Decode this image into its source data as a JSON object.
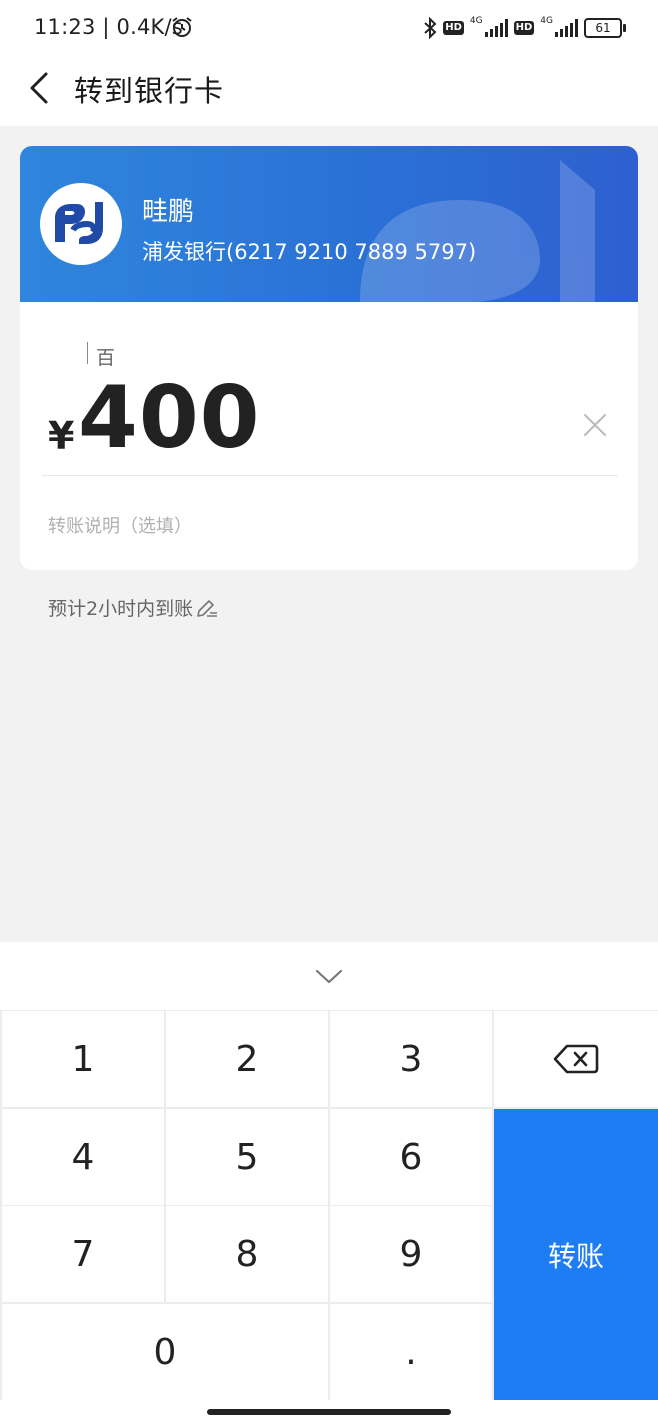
{
  "status_bar": {
    "time_speed": "11:23 | 0.4K/s",
    "network_1": "4G",
    "network_2": "4G",
    "hd_label": "HD",
    "battery": "61"
  },
  "header": {
    "title": "转到银行卡"
  },
  "payee": {
    "name": "畦鹏",
    "bank_account": "浦发银行(6217 9210 7889 5797)"
  },
  "amount": {
    "unit_hint": "百",
    "currency_symbol": "¥",
    "value": "400"
  },
  "remark": {
    "placeholder": "转账说明（选填）"
  },
  "eta": {
    "text": "预计2小时内到账"
  },
  "keypad": {
    "k1": "1",
    "k2": "2",
    "k3": "3",
    "k4": "4",
    "k5": "5",
    "k6": "6",
    "k7": "7",
    "k8": "8",
    "k9": "9",
    "k0": "0",
    "kdot": ".",
    "submit": "转账"
  },
  "colors": {
    "accent": "#1e7cf5",
    "banner": "#2a6fd6"
  }
}
